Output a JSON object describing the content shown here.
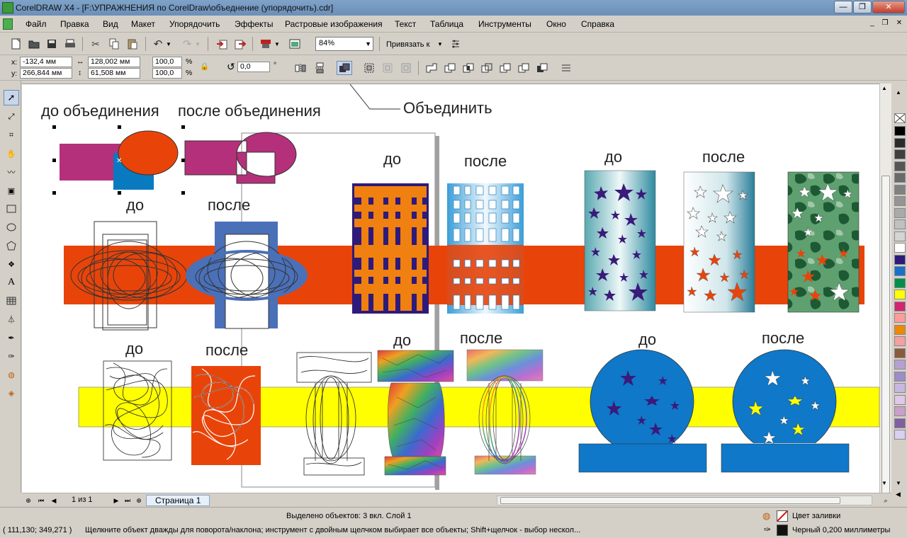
{
  "window": {
    "title": "CorelDRAW X4 - [F:\\УПРАЖНЕНИЯ по CorelDraw\\объеднение (упорядочить).cdr]"
  },
  "menu": {
    "items": [
      "Файл",
      "Правка",
      "Вид",
      "Макет",
      "Упорядочить",
      "Эффекты",
      "Растровые изображения",
      "Текст",
      "Таблица",
      "Инструменты",
      "Окно",
      "Справка"
    ]
  },
  "toolbar": {
    "zoom_value": "84%",
    "snap_label": "Привязать к"
  },
  "propbar": {
    "x_label": "x:",
    "x_value": "-132,4 мм",
    "y_label": "y:",
    "y_value": "266,844 мм",
    "width_value": "128,002 мм",
    "height_value": "61,508 мм",
    "scale_x": "100,0",
    "scale_y": "100,0",
    "percent": "%",
    "angle_value": "0,0",
    "degree": "°"
  },
  "canvas": {
    "labels": {
      "before_union": "до объединения",
      "after_union": "после объединения",
      "combine_callout": "Объединить",
      "do": "до",
      "posle": "после"
    }
  },
  "pager": {
    "page_count": "1 из 1",
    "page_tab": "Страница 1"
  },
  "status": {
    "selected": "Выделено объектов: 3 вкл. Слой 1",
    "coords": "( 111,130; 349,271 )",
    "hint": "Щелкните объект дважды для поворота/наклона; инструмент с двойным щелчком выбирает все объекты; Shift+щелчок - выбор нескол...",
    "fill_label": "Цвет заливки",
    "outline_label": "Черный  0,200 миллиметры"
  },
  "palette": {
    "colors": [
      "#000000",
      "#2b2b2b",
      "#3f3f3f",
      "#555555",
      "#6a6a6a",
      "#808080",
      "#959595",
      "#aaaaaa",
      "#c0c0c0",
      "#d5d5d5",
      "#ffffff",
      "#2e1a7a",
      "#1a6fcc",
      "#00904a",
      "#ffff00",
      "#d4246e",
      "#ff9b9b",
      "#ee8800",
      "#f4a0a0",
      "#8a5a3c",
      "#b6a0d0",
      "#9c8cc8",
      "#c8b8e0",
      "#e0c8e8",
      "#c8a0c8",
      "#8060a0",
      "#d8d0f0"
    ]
  },
  "colors": {
    "orange": "#e8440a",
    "magenta": "#b5307a",
    "blue_rect": "#0a7ac0",
    "navy": "#2e1a7a",
    "orange_art": "#f08010",
    "yellow": "#ffff00",
    "circle_blue": "#0f78c8",
    "slate_blue": "#4a70b8"
  }
}
